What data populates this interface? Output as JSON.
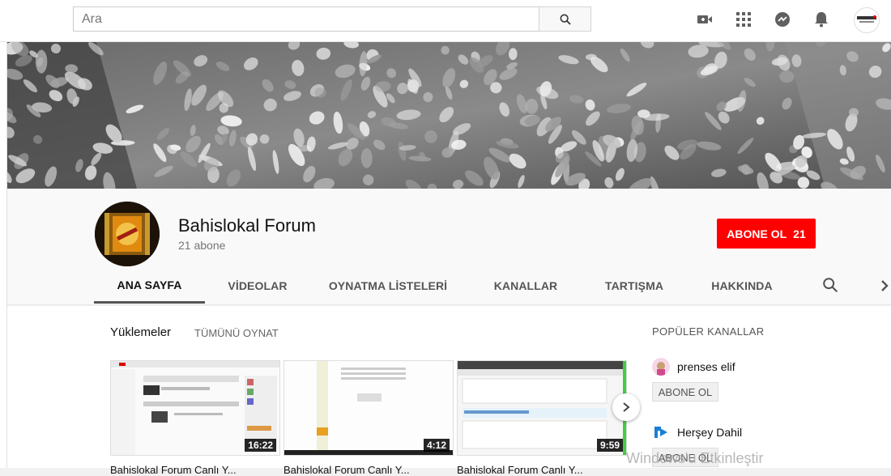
{
  "search": {
    "placeholder": "Ara"
  },
  "top_icons": [
    "video-camera-icon",
    "apps-grid-icon",
    "messages-icon",
    "bell-icon"
  ],
  "channel": {
    "name": "Bahislokal Forum",
    "subscribers": "21 abone",
    "subscribe_label": "ABONE OL",
    "subscribe_count": "21"
  },
  "tabs": [
    {
      "label": "ANA SAYFA",
      "active": true
    },
    {
      "label": "VİDEOLAR"
    },
    {
      "label": "OYNATMA LİSTELERİ"
    },
    {
      "label": "KANALLAR"
    },
    {
      "label": "TARTIŞMA"
    },
    {
      "label": "HAKKINDA"
    }
  ],
  "uploads": {
    "title": "Yüklemeler",
    "play_all": "TÜMÜNÜ OYNAT",
    "videos": [
      {
        "duration": "16:22",
        "title": "Bahislokal Forum Canlı Y..."
      },
      {
        "duration": "4:12",
        "title": "Bahislokal Forum Canlı Y..."
      },
      {
        "duration": "9:59",
        "title": "Bahislokal Forum Canlı Y..."
      }
    ]
  },
  "popular_channels": {
    "title": "POPÜLER KANALLAR",
    "items": [
      {
        "name": "prenses elif",
        "subscribe_label": "ABONE OL"
      },
      {
        "name": "Herşey Dahil",
        "subscribe_label": "ABONE OL"
      }
    ]
  },
  "watermark": "Windows'u Etkinleştir",
  "colors": {
    "subscribe": "#ff0000",
    "header_bg": "#f9f9f9",
    "topbar_bg": "#ffffff"
  }
}
